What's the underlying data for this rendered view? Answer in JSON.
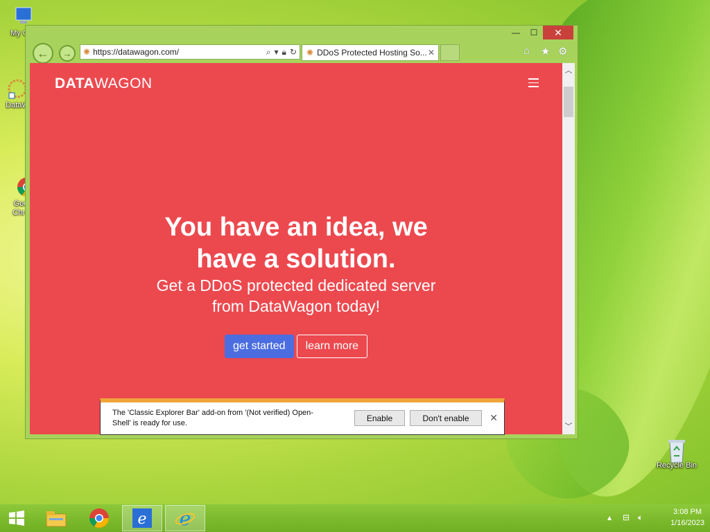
{
  "desktop": {
    "icons": [
      {
        "label": "My Co"
      },
      {
        "label": "DataW"
      },
      {
        "label": "Goo\nChr"
      },
      {
        "label": "Recycle Bin"
      }
    ]
  },
  "browser": {
    "address": "https://datawagon.com/",
    "tab_title": "DDoS Protected Hosting So...",
    "window_controls": {
      "minimize": "—",
      "maximize": "☐",
      "close": "✕"
    },
    "icons": [
      "back-arrow-icon",
      "forward-arrow-icon",
      "search-icon",
      "lock-icon",
      "refresh-icon",
      "home-icon",
      "star-icon",
      "gear-icon"
    ]
  },
  "page": {
    "brand_bold": "DATA",
    "brand_rest": "WAGON",
    "headline_line1": "You have an idea, we",
    "headline_line2": "have a solution.",
    "sub_line1": "Get a DDoS protected dedicated server",
    "sub_line2": "from DataWagon today!",
    "btn_primary": "get started",
    "btn_secondary": "learn more",
    "colors": {
      "background": "#ec494f",
      "primary_button": "#4b6de0"
    }
  },
  "notification": {
    "message": "The 'Classic Explorer Bar' add-on from '(Not verified) Open-Shell' is ready for use.",
    "enable": "Enable",
    "dont_enable": "Don't enable"
  },
  "taskbar": {
    "time": "3:08 PM",
    "date": "1/16/2023"
  }
}
